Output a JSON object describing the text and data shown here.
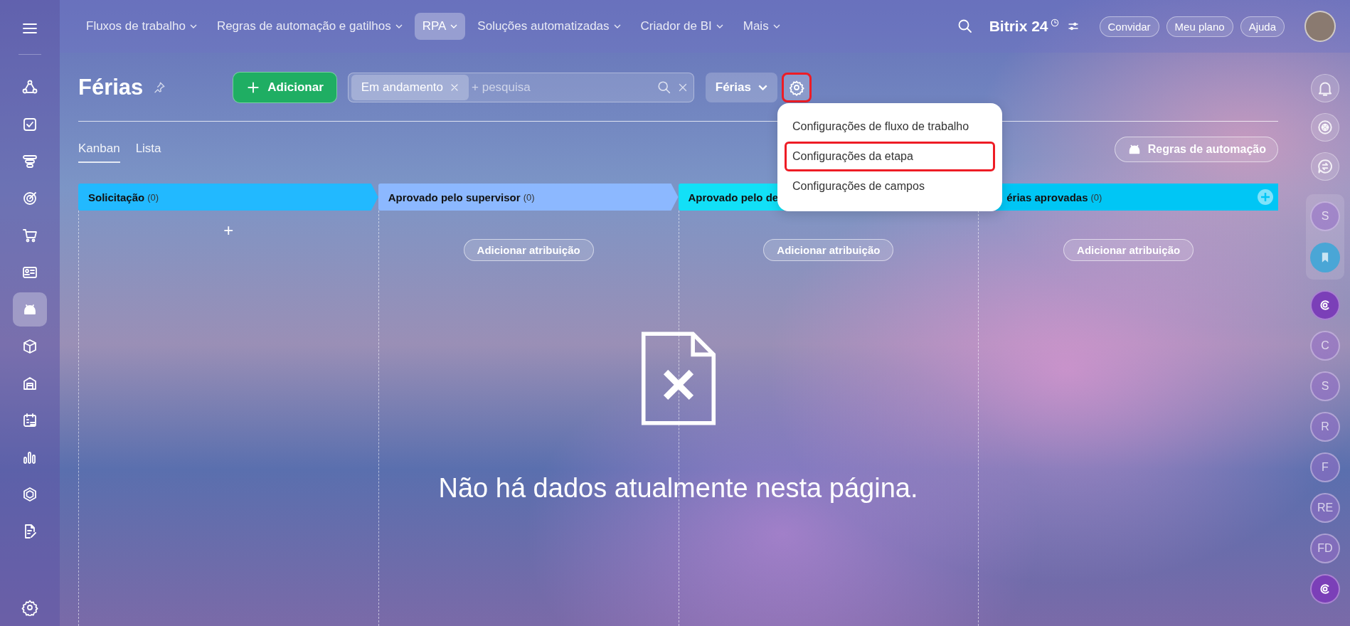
{
  "top_nav": {
    "items": [
      {
        "label": "Fluxos de trabalho",
        "selected": false
      },
      {
        "label": "Regras de automação e gatilhos",
        "selected": false
      },
      {
        "label": "RPA",
        "selected": true
      },
      {
        "label": "Soluções automatizadas",
        "selected": false
      },
      {
        "label": "Criador de BI",
        "selected": false
      },
      {
        "label": "Mais",
        "selected": false
      }
    ],
    "logo": {
      "name": "Bitrix",
      "number": "24"
    },
    "buttons": [
      "Convidar",
      "Meu plano",
      "Ajuda"
    ]
  },
  "left_sidebar": {
    "items": [
      {
        "selected": false
      },
      {
        "selected": false
      },
      {
        "selected": false
      },
      {
        "selected": false
      },
      {
        "selected": false
      },
      {
        "selected": false
      },
      {
        "selected": true
      },
      {
        "selected": false
      },
      {
        "selected": false
      },
      {
        "selected": false
      },
      {
        "selected": false
      },
      {
        "selected": false
      },
      {
        "selected": false
      }
    ]
  },
  "page": {
    "title": "Férias",
    "add_button": "Adicionar",
    "filter": {
      "tag": "Em andamento",
      "placeholder": "+ pesquisa"
    },
    "dropdown": "Férias",
    "settings_highlighted": true,
    "view_tabs": [
      {
        "label": "Kanban",
        "selected": true
      },
      {
        "label": "Lista",
        "selected": false
      }
    ],
    "automation_button": "Regras de automação"
  },
  "settings_menu": {
    "items": [
      {
        "label": "Configurações de fluxo de trabalho",
        "highlighted": false
      },
      {
        "label": "Configurações da etapa",
        "highlighted": true
      },
      {
        "label": "Configurações de campos",
        "highlighted": false
      }
    ]
  },
  "columns": [
    {
      "title": "Solicitação",
      "count": "(0)",
      "color": "#22b9ff",
      "kind": "plus",
      "action": "+",
      "add_stage": false
    },
    {
      "title": "Aprovado pelo supervisor",
      "count": "(0)",
      "color": "#8cb8ff",
      "kind": "button",
      "action": "Adicionar atribuição",
      "add_stage": false
    },
    {
      "title": "Aprovado pelo de",
      "color": "#12e0f7",
      "kind": "button",
      "action": "Adicionar atribuição",
      "add_stage": false
    },
    {
      "title": "érias aprovadas",
      "count": "(0)",
      "color": "#00c6f5",
      "kind": "button",
      "action": "Adicionar atribuição",
      "add_stage": true
    }
  ],
  "empty_state": {
    "message": "Não há dados atualmente nesta página."
  },
  "right_sidebar": {
    "avatars": [
      {
        "kind": "letter",
        "label": "S"
      },
      {
        "kind": "bookmark"
      },
      {
        "kind": "copilot"
      },
      {
        "kind": "letter",
        "label": "C"
      },
      {
        "kind": "letter",
        "label": "S"
      },
      {
        "kind": "letter",
        "label": "R"
      },
      {
        "kind": "letter",
        "label": "F"
      },
      {
        "kind": "letter",
        "label": "RE"
      },
      {
        "kind": "letter",
        "label": "FD"
      },
      {
        "kind": "copilot"
      }
    ]
  }
}
